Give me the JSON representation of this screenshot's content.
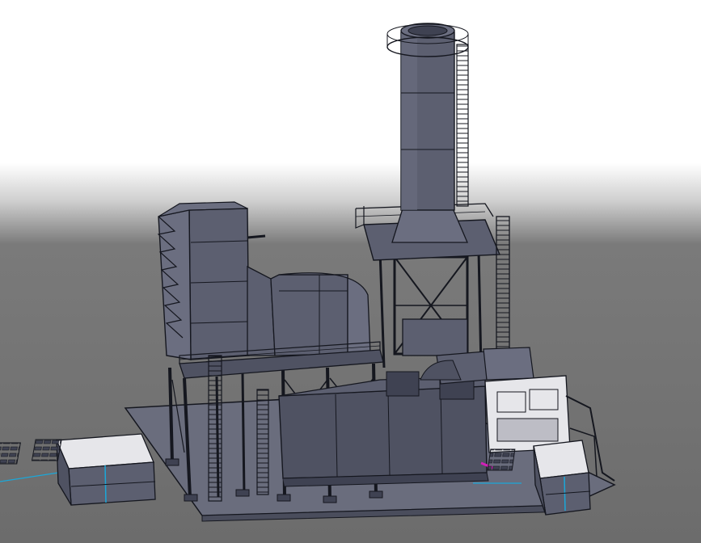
{
  "scene": {
    "colors": {
      "background_top": "#ffffff",
      "background_mid": "#7c7c7c",
      "background_bottom": "#6e6e6e",
      "steel": "#5c5f70",
      "steel_light": "#6b6e80",
      "steel_dark": "#3f4252",
      "edge": "#15171f",
      "white_part": "#e6e6ea",
      "highlight_cyan": "#1ba7d8",
      "highlight_magenta": "#d21fb8",
      "base_slab": "#6a6d7d"
    }
  }
}
